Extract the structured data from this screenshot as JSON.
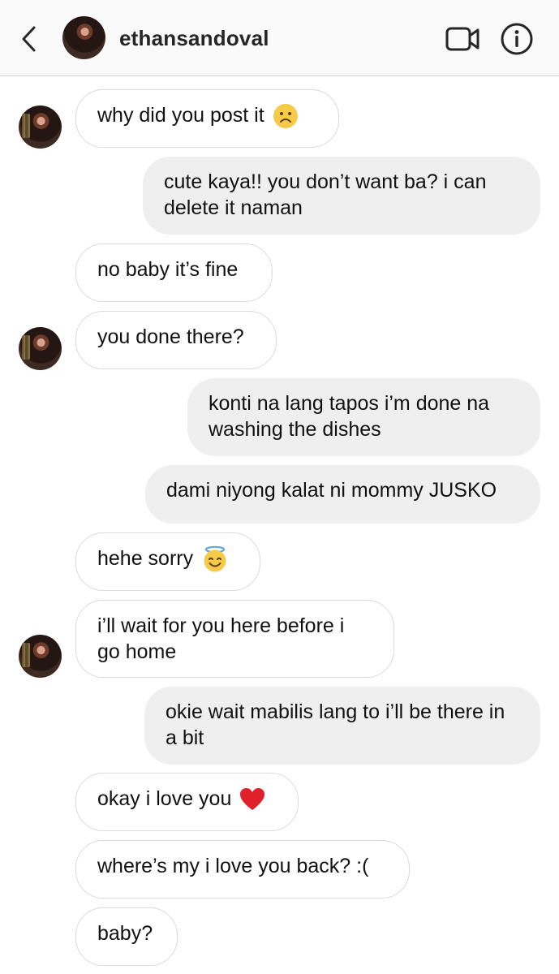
{
  "header": {
    "username": "ethansandoval",
    "back_icon": "chevron-left-icon",
    "video_icon": "video-camera-icon",
    "info_icon": "info-icon"
  },
  "colors": {
    "incoming_border": "#dbdbdb",
    "outgoing_bg": "#efefef",
    "header_bg": "#fafafa"
  },
  "messages": [
    {
      "from": "them",
      "text": "why did you post it",
      "emoji": "frowning-face"
    },
    {
      "from": "me",
      "text": "cute kaya!! you don’t want ba? i can delete it naman"
    },
    {
      "from": "them",
      "text": "no baby it’s fine"
    },
    {
      "from": "them",
      "text": "you done there?"
    },
    {
      "from": "me",
      "text": "konti na lang tapos i’m done na washing the dishes"
    },
    {
      "from": "me",
      "text": "dami niyong kalat ni mommy JUSKO"
    },
    {
      "from": "them",
      "text": "hehe sorry",
      "emoji": "smiling-face-with-halo"
    },
    {
      "from": "them",
      "text": "i’ll wait for you here before i go home"
    },
    {
      "from": "me",
      "text": "okie wait mabilis lang to i’ll be there in a bit"
    },
    {
      "from": "them",
      "text": "okay i love you",
      "emoji": "red-heart"
    },
    {
      "from": "them",
      "text": "where’s my i love you back? :("
    },
    {
      "from": "them",
      "text": "baby?"
    }
  ]
}
